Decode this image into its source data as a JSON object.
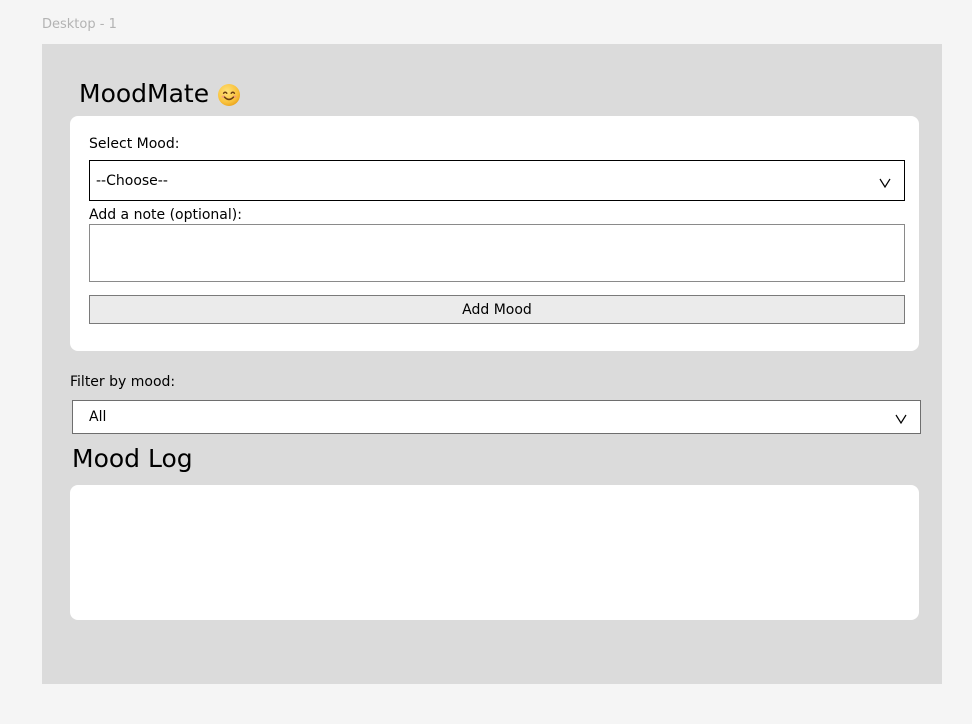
{
  "canvas": {
    "frame_label": "Desktop - 1"
  },
  "app": {
    "title": "MoodMate",
    "title_icon": "smiling-face-emoji-icon"
  },
  "form": {
    "mood_label": "Select Mood:",
    "mood_select_value": "--Choose--",
    "note_label": "Add a note (optional):",
    "note_value": "",
    "add_button_label": "Add Mood"
  },
  "filter": {
    "label": "Filter by mood:",
    "selected_value": "All"
  },
  "log": {
    "title": "Mood Log",
    "entries": []
  },
  "colors": {
    "canvas_background": "#f5f5f5",
    "frame_background": "#dbdbdb",
    "card_background": "#ffffff",
    "button_background": "#ebebeb",
    "emoji_face": "#f9c23c"
  }
}
